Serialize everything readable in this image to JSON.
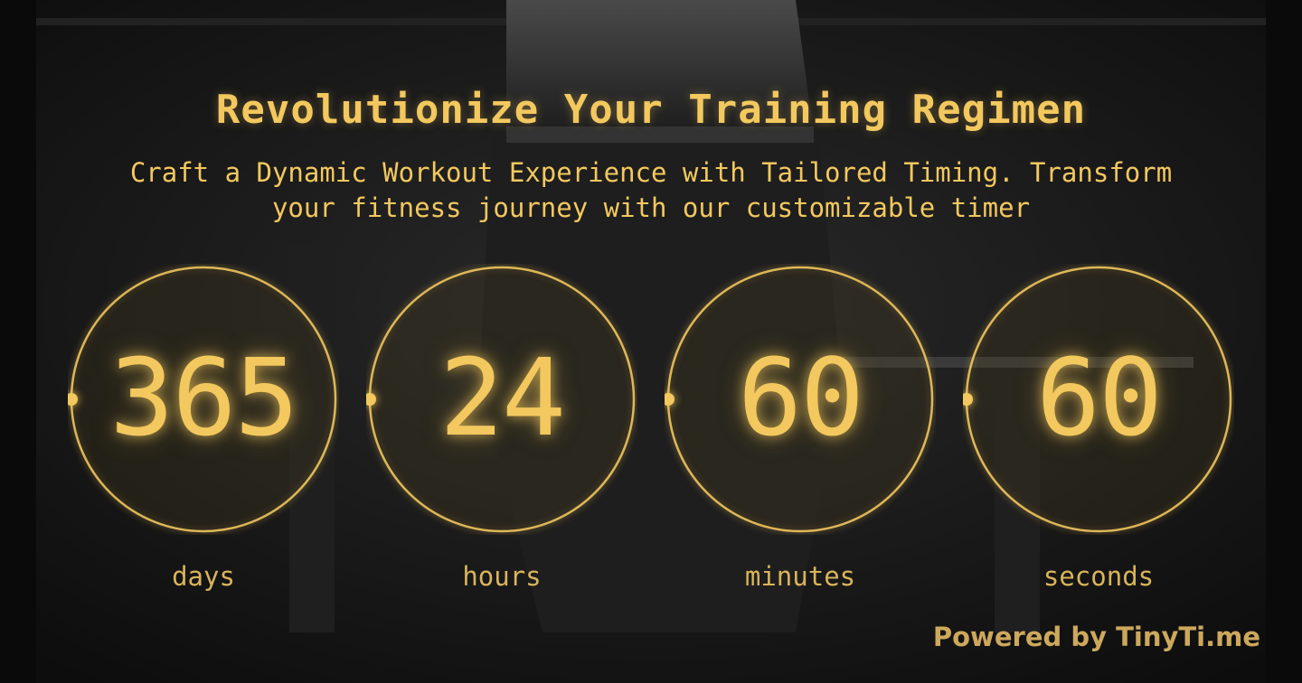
{
  "header": {
    "title": "Revolutionize Your Training Regimen",
    "subtitle_line1": "Craft a Dynamic Workout Experience with Tailored Timing. Transform",
    "subtitle_line2": "your fitness journey with our customizable timer"
  },
  "countdown": [
    {
      "value": "365",
      "label": "days"
    },
    {
      "value": "24",
      "label": "hours"
    },
    {
      "value": "60",
      "label": "minutes"
    },
    {
      "value": "60",
      "label": "seconds"
    }
  ],
  "footer": {
    "powered_by": "Powered by TinyTi.me"
  },
  "colors": {
    "accent": "#F3C85E",
    "label": "#D9B45A",
    "footer": "#CDA85C",
    "background": "#141414"
  }
}
